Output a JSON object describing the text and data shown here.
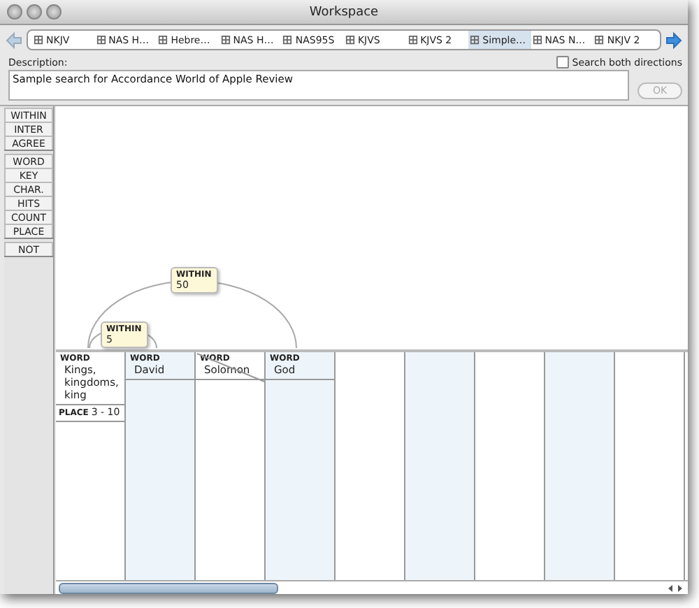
{
  "window": {
    "title": "Workspace"
  },
  "tabs": [
    {
      "label": "NKJV",
      "selected": false
    },
    {
      "label": "NAS H…",
      "selected": false
    },
    {
      "label": "Hebre…",
      "selected": false
    },
    {
      "label": "NAS H…",
      "selected": false
    },
    {
      "label": "NAS95S",
      "selected": false
    },
    {
      "label": "KJVS",
      "selected": false
    },
    {
      "label": "KJVS 2",
      "selected": false
    },
    {
      "label": "Simple…",
      "selected": true
    },
    {
      "label": "NAS N…",
      "selected": false
    },
    {
      "label": "NKJV 2",
      "selected": false
    }
  ],
  "description": {
    "label": "Description:",
    "value": "Sample search for Accordance World of Apple Review"
  },
  "search_both_directions": {
    "label": "Search both directions",
    "checked": false
  },
  "ok_button": {
    "label": "OK",
    "disabled": true
  },
  "command_groups": [
    [
      "WITHIN",
      "INTER",
      "AGREE"
    ],
    [
      "WORD",
      "KEY",
      "CHAR.",
      "HITS",
      "COUNT",
      "PLACE"
    ],
    [
      "NOT"
    ]
  ],
  "proximity_links": [
    {
      "label": "WITHIN",
      "value": "50"
    },
    {
      "label": "WITHIN",
      "value": "5"
    }
  ],
  "columns": [
    {
      "items": [
        {
          "label": "WORD",
          "value": "Kings, kingdoms, king"
        },
        {
          "label": "PLACE",
          "value": "3 - 10"
        }
      ]
    },
    {
      "items": [
        {
          "label": "WORD",
          "value": "David"
        }
      ]
    },
    {
      "items": [
        {
          "label": "WORD",
          "value": "Solomon"
        }
      ]
    },
    {
      "items": [
        {
          "label": "WORD",
          "value": "God"
        }
      ]
    },
    {},
    {},
    {},
    {},
    {}
  ]
}
